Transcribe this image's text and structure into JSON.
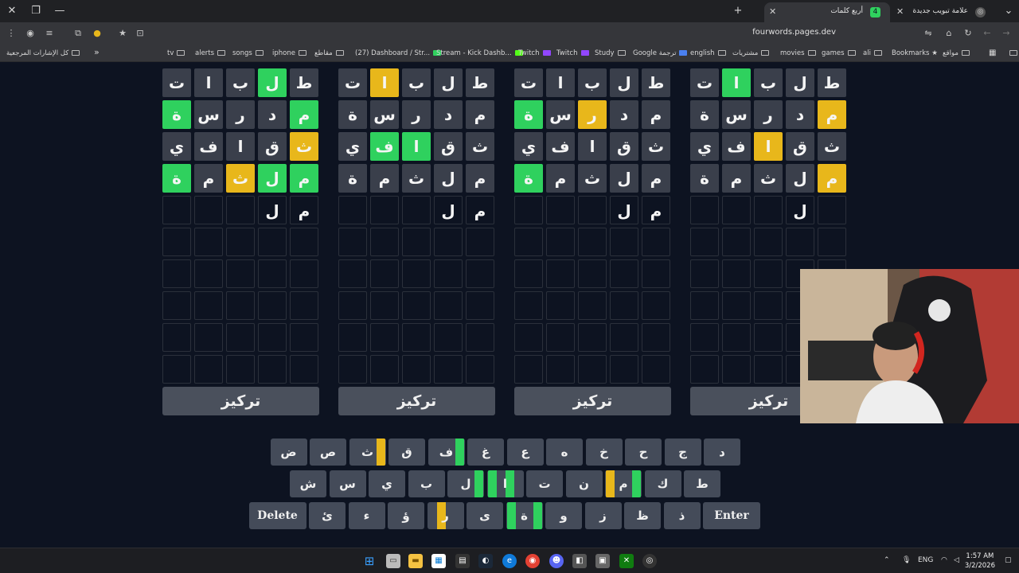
{
  "browser": {
    "tabs": [
      {
        "title": "علامة تبويب جديدة"
      },
      {
        "title": "أربع كلمات"
      }
    ],
    "url": "fourwords.pages.dev",
    "bookmarks_all": "كل الإشارات المرجعية",
    "bookmarks": [
      "tv",
      "alerts",
      "songs",
      "iphone",
      "مقاطع",
      "(27) Dashboard / Str...",
      "Stream - Kick Dashb...",
      "Twitch",
      "Twitch",
      "Study",
      "Google ترجمة",
      "english",
      "مشتريات",
      "movies",
      "games",
      "ali",
      "Bookmarks",
      "مواقع"
    ]
  },
  "boards": [
    {
      "rows": [
        [
          {
            "ch": "ط",
            "s": "filled"
          },
          {
            "ch": "ل",
            "s": "green"
          },
          {
            "ch": "ب",
            "s": "filled"
          },
          {
            "ch": "ا",
            "s": "filled"
          },
          {
            "ch": "ت",
            "s": "filled"
          }
        ],
        [
          {
            "ch": "م",
            "s": "green"
          },
          {
            "ch": "د",
            "s": "filled"
          },
          {
            "ch": "ر",
            "s": "filled"
          },
          {
            "ch": "س",
            "s": "filled"
          },
          {
            "ch": "ة",
            "s": "green"
          }
        ],
        [
          {
            "ch": "ث",
            "s": "yellow"
          },
          {
            "ch": "ق",
            "s": "filled"
          },
          {
            "ch": "ا",
            "s": "filled"
          },
          {
            "ch": "ف",
            "s": "filled"
          },
          {
            "ch": "ي",
            "s": "filled"
          }
        ],
        [
          {
            "ch": "م",
            "s": "green"
          },
          {
            "ch": "ل",
            "s": "green"
          },
          {
            "ch": "ث",
            "s": "yellow"
          },
          {
            "ch": "م",
            "s": "filled"
          },
          {
            "ch": "ة",
            "s": "green"
          }
        ],
        [
          {
            "ch": "م",
            "s": "empty"
          },
          {
            "ch": "ل",
            "s": "empty"
          },
          {
            "ch": "",
            "s": "empty"
          },
          {
            "ch": "",
            "s": "empty"
          },
          {
            "ch": "",
            "s": "empty"
          }
        ]
      ],
      "focus_label": "تركيز"
    },
    {
      "rows": [
        [
          {
            "ch": "ط",
            "s": "filled"
          },
          {
            "ch": "ل",
            "s": "filled"
          },
          {
            "ch": "ب",
            "s": "filled"
          },
          {
            "ch": "ا",
            "s": "yellow"
          },
          {
            "ch": "ت",
            "s": "filled"
          }
        ],
        [
          {
            "ch": "م",
            "s": "filled"
          },
          {
            "ch": "د",
            "s": "filled"
          },
          {
            "ch": "ر",
            "s": "filled"
          },
          {
            "ch": "س",
            "s": "filled"
          },
          {
            "ch": "ة",
            "s": "filled"
          }
        ],
        [
          {
            "ch": "ث",
            "s": "filled"
          },
          {
            "ch": "ق",
            "s": "filled"
          },
          {
            "ch": "ا",
            "s": "green"
          },
          {
            "ch": "ف",
            "s": "green"
          },
          {
            "ch": "ي",
            "s": "filled"
          }
        ],
        [
          {
            "ch": "م",
            "s": "filled"
          },
          {
            "ch": "ل",
            "s": "filled"
          },
          {
            "ch": "ث",
            "s": "filled"
          },
          {
            "ch": "م",
            "s": "filled"
          },
          {
            "ch": "ة",
            "s": "filled"
          }
        ],
        [
          {
            "ch": "م",
            "s": "empty"
          },
          {
            "ch": "ل",
            "s": "empty"
          },
          {
            "ch": "",
            "s": "empty"
          },
          {
            "ch": "",
            "s": "empty"
          },
          {
            "ch": "",
            "s": "empty"
          }
        ]
      ],
      "focus_label": "تركيز"
    },
    {
      "rows": [
        [
          {
            "ch": "ط",
            "s": "filled"
          },
          {
            "ch": "ل",
            "s": "filled"
          },
          {
            "ch": "ب",
            "s": "filled"
          },
          {
            "ch": "ا",
            "s": "filled"
          },
          {
            "ch": "ت",
            "s": "filled"
          }
        ],
        [
          {
            "ch": "م",
            "s": "filled"
          },
          {
            "ch": "د",
            "s": "filled"
          },
          {
            "ch": "ر",
            "s": "yellow"
          },
          {
            "ch": "س",
            "s": "filled"
          },
          {
            "ch": "ة",
            "s": "green"
          }
        ],
        [
          {
            "ch": "ث",
            "s": "filled"
          },
          {
            "ch": "ق",
            "s": "filled"
          },
          {
            "ch": "ا",
            "s": "filled"
          },
          {
            "ch": "ف",
            "s": "filled"
          },
          {
            "ch": "ي",
            "s": "filled"
          }
        ],
        [
          {
            "ch": "م",
            "s": "filled"
          },
          {
            "ch": "ل",
            "s": "filled"
          },
          {
            "ch": "ث",
            "s": "filled"
          },
          {
            "ch": "م",
            "s": "filled"
          },
          {
            "ch": "ة",
            "s": "green"
          }
        ],
        [
          {
            "ch": "م",
            "s": "empty"
          },
          {
            "ch": "ل",
            "s": "empty"
          },
          {
            "ch": "",
            "s": "empty"
          },
          {
            "ch": "",
            "s": "empty"
          },
          {
            "ch": "",
            "s": "empty"
          }
        ]
      ],
      "focus_label": "تركيز"
    },
    {
      "rows": [
        [
          {
            "ch": "ط",
            "s": "filled"
          },
          {
            "ch": "ل",
            "s": "filled"
          },
          {
            "ch": "ب",
            "s": "filled"
          },
          {
            "ch": "ا",
            "s": "green"
          },
          {
            "ch": "ت",
            "s": "filled"
          }
        ],
        [
          {
            "ch": "م",
            "s": "yellow"
          },
          {
            "ch": "د",
            "s": "filled"
          },
          {
            "ch": "ر",
            "s": "filled"
          },
          {
            "ch": "س",
            "s": "filled"
          },
          {
            "ch": "ة",
            "s": "filled"
          }
        ],
        [
          {
            "ch": "ث",
            "s": "filled"
          },
          {
            "ch": "ق",
            "s": "filled"
          },
          {
            "ch": "ا",
            "s": "yellow"
          },
          {
            "ch": "ف",
            "s": "filled"
          },
          {
            "ch": "ي",
            "s": "filled"
          }
        ],
        [
          {
            "ch": "م",
            "s": "yellow"
          },
          {
            "ch": "ل",
            "s": "filled"
          },
          {
            "ch": "ث",
            "s": "filled"
          },
          {
            "ch": "م",
            "s": "filled"
          },
          {
            "ch": "ة",
            "s": "filled"
          }
        ],
        [
          {
            "ch": "",
            "s": "empty"
          },
          {
            "ch": "ل",
            "s": "empty"
          },
          {
            "ch": "",
            "s": "empty"
          },
          {
            "ch": "",
            "s": "empty"
          },
          {
            "ch": "",
            "s": "empty"
          }
        ]
      ],
      "focus_label": "تركيز"
    }
  ],
  "keyboard": {
    "rows": [
      [
        {
          "label": "د",
          "marks": []
        },
        {
          "label": "ج",
          "marks": []
        },
        {
          "label": "ح",
          "marks": []
        },
        {
          "label": "خ",
          "marks": []
        },
        {
          "label": "ه",
          "marks": []
        },
        {
          "label": "ع",
          "marks": []
        },
        {
          "label": "غ",
          "marks": []
        },
        {
          "label": "ف",
          "marks": [
            "green",
            "none",
            "none",
            "none"
          ]
        },
        {
          "label": "ق",
          "marks": []
        },
        {
          "label": "ث",
          "marks": [
            "yellow",
            "none",
            "none",
            "none"
          ]
        },
        {
          "label": "ص",
          "marks": []
        },
        {
          "label": "ض",
          "marks": []
        }
      ],
      [
        {
          "label": "ط",
          "marks": []
        },
        {
          "label": "ك",
          "marks": []
        },
        {
          "label": "م",
          "marks": [
            "green",
            "none",
            "none",
            "yellow"
          ]
        },
        {
          "label": "ن",
          "marks": []
        },
        {
          "label": "ت",
          "marks": []
        },
        {
          "label": "ا",
          "marks": [
            "none",
            "green",
            "none",
            "green"
          ]
        },
        {
          "label": "ل",
          "marks": [
            "green",
            "none",
            "none",
            "none"
          ]
        },
        {
          "label": "ب",
          "marks": []
        },
        {
          "label": "ي",
          "marks": []
        },
        {
          "label": "س",
          "marks": []
        },
        {
          "label": "ش",
          "marks": []
        }
      ],
      [
        {
          "label": "Enter",
          "marks": [],
          "wide": true
        },
        {
          "label": "ذ",
          "marks": []
        },
        {
          "label": "ظ",
          "marks": []
        },
        {
          "label": "ز",
          "marks": []
        },
        {
          "label": "و",
          "marks": []
        },
        {
          "label": "ة",
          "marks": [
            "green",
            "none",
            "none",
            "green"
          ]
        },
        {
          "label": "ى",
          "marks": []
        },
        {
          "label": "ر",
          "marks": [
            "none",
            "none",
            "yellow",
            "none"
          ]
        },
        {
          "label": "ؤ",
          "marks": []
        },
        {
          "label": "ء",
          "marks": []
        },
        {
          "label": "ئ",
          "marks": []
        },
        {
          "label": "Delete",
          "marks": [],
          "wide": true
        }
      ]
    ]
  },
  "colors": {
    "green": "#2fd15e",
    "yellow": "#e8b71b",
    "tile": "#3a3f4b",
    "key": "#444b59",
    "background": "#0d1321"
  },
  "taskbar": {
    "lang": "ENG",
    "time": "1:57 AM",
    "date": "3/2/2026",
    "icons": [
      "windows-start-icon",
      "task-view-icon",
      "file-explorer-icon",
      "microsoft-store-icon",
      "calculator-icon",
      "steam-icon",
      "edge-icon",
      "chrome-icon",
      "discord-icon",
      "app-icon",
      "app-icon",
      "xbox-icon",
      "obs-icon"
    ]
  }
}
